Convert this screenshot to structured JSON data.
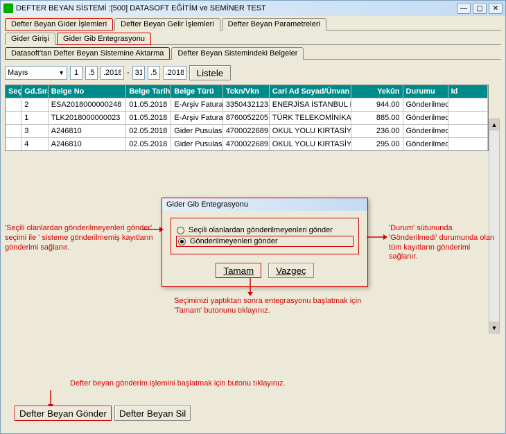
{
  "window": {
    "title": "DEFTER BEYAN SİSTEMİ  :[500]  DATASOFT EĞİTİM ve SEMİNER TEST"
  },
  "mainTabs": [
    {
      "label": "Defter Beyan Gider İşlemleri",
      "active": true
    },
    {
      "label": "Defter Beyan Gelir İşlemleri",
      "active": false
    },
    {
      "label": "Defter Beyan Parametreleri",
      "active": false
    }
  ],
  "subTabs1": [
    {
      "label": "Gider Girişi",
      "active": false
    },
    {
      "label": "Gider Gib Entegrasyonu",
      "active": true
    }
  ],
  "subTabs2": [
    {
      "label": "Datasoft'tan Defter Beyan Sistemine Aktarma",
      "active": true
    },
    {
      "label": "Defter Beyan Sistemindeki Belgeler",
      "active": false
    }
  ],
  "filter": {
    "month": "Mayıs",
    "d1_day": "1",
    "d1_mon": ".5",
    "d1_year": ".2018",
    "d2_day": "31",
    "d2_mon": ".5",
    "d2_year": ".2018",
    "list_btn": "Listele"
  },
  "grid": {
    "headers": {
      "sec": "Seç",
      "sira": "Gd.Sıra",
      "bno": "Belge No",
      "btar": "Belge Tarihi",
      "btur": "Belge Türü",
      "tckn": "Tckn/Vkn",
      "cari": "Cari Ad Soyad/Ünvan",
      "yekun": "Yekûn",
      "durum": "Durumu",
      "id": "Id"
    },
    "rows": [
      {
        "sira": "2",
        "bno": "ESA2018000000248",
        "btar": "01.05.2018",
        "btur": "E-Arşiv Fatura",
        "tckn": "3350432123",
        "cari": "ENERJİSA İSTANBUL E",
        "yekun": "944.00",
        "durum": "Gönderilmedi",
        "id": ""
      },
      {
        "sira": "1",
        "bno": "TLK2018000000023",
        "btar": "01.05.2018",
        "btur": "E-Arşiv Fatura",
        "tckn": "8760052205",
        "cari": "TÜRK TELEKOMİNİKAS",
        "yekun": "885.00",
        "durum": "Gönderilmedi",
        "id": ""
      },
      {
        "sira": "3",
        "bno": "A246810",
        "btar": "02.05.2018",
        "btur": "Gider Pusulası",
        "tckn": "4700022689",
        "cari": "OKUL YOLU KIRTASİYE",
        "yekun": "236.00",
        "durum": "Gönderilmedi",
        "id": ""
      },
      {
        "sira": "4",
        "bno": "A246810",
        "btar": "02.05.2018",
        "btur": "Gider Pusulası",
        "tckn": "4700022689",
        "cari": "OKUL YOLU KIRTASİYE",
        "yekun": "295.00",
        "durum": "Gönderilmedi",
        "id": ""
      }
    ]
  },
  "dialog": {
    "title": "Gider Gib Entegrasyonu",
    "opt1": "Seçili olanlardan gönderilmeyenleri gönder",
    "opt2": "Gönderilmeyenleri gönder",
    "btn_tamam": "Tamam",
    "btn_vazgec": "Vazgeç"
  },
  "annotations": {
    "left": "'Seçili olanlardan gönderilmeyenleri gönder' seçimi ile ' sisteme gönderilmemiş kayıtların gönderimi sağlanır.",
    "right": "'Durum' sütununda 'Gönderilmedi' durumunda olan tüm kayıtların gönderimi  sağlanır.",
    "bottom": "Seçiminizi yaptıktan sonra entegrasyonu başlatmak için 'Tamam' butonunu tıklayınız.",
    "footer": "Defter beyan gönderim işlemini başlatmak için butonu tıklayınız."
  },
  "footer": {
    "send": "Defter Beyan Gönder",
    "del": "Defter Beyan Sil"
  }
}
